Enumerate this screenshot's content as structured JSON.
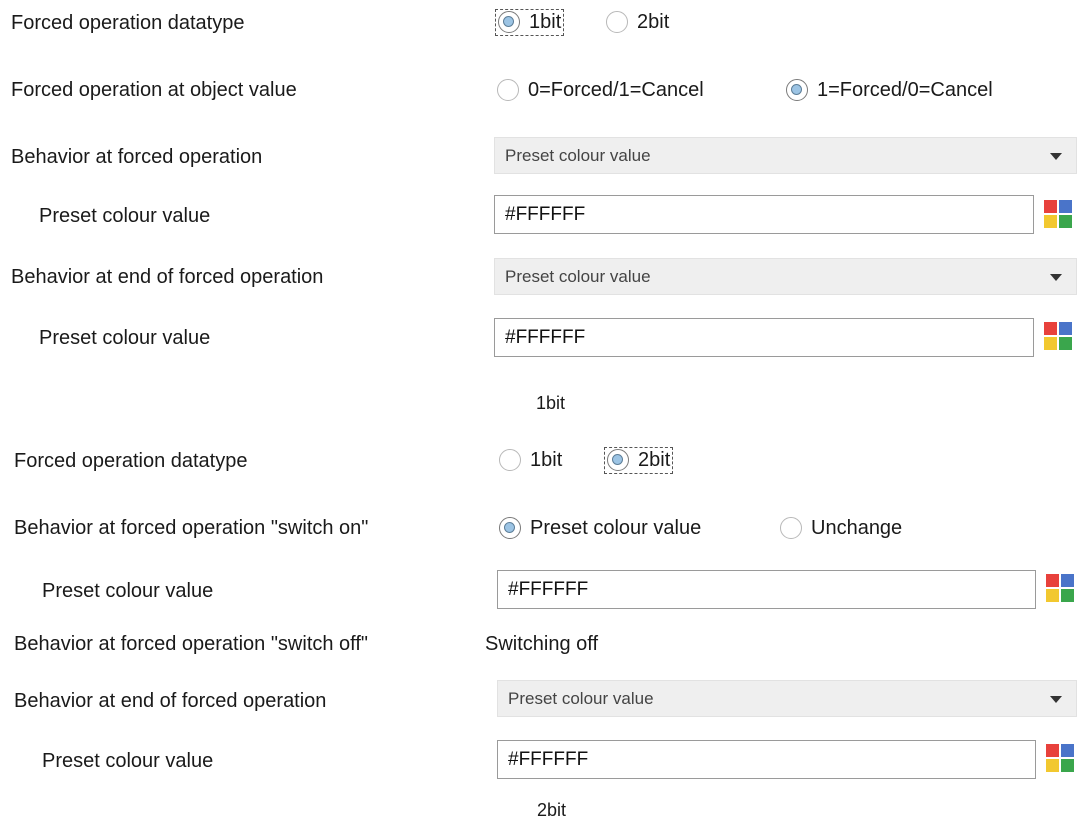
{
  "section1": {
    "datatype": {
      "label": "Forced operation datatype",
      "options": [
        "1bit",
        "2bit"
      ],
      "selected": "1bit"
    },
    "object_value": {
      "label": "Forced operation at object value",
      "options": [
        "0=Forced/1=Cancel",
        "1=Forced/0=Cancel"
      ],
      "selected": "1=Forced/0=Cancel"
    },
    "behavior_forced": {
      "label": "Behavior at forced operation",
      "value": "Preset colour value"
    },
    "preset1": {
      "label": "Preset colour value",
      "value": "#FFFFFF"
    },
    "behavior_end": {
      "label": "Behavior at end of forced operation",
      "value": "Preset colour value"
    },
    "preset2": {
      "label": "Preset colour value",
      "value": "#FFFFFF"
    },
    "caption": "1bit"
  },
  "section2": {
    "datatype": {
      "label": "Forced operation datatype",
      "options": [
        "1bit",
        "2bit"
      ],
      "selected": "2bit"
    },
    "switch_on": {
      "label": "Behavior at forced operation \"switch on\"",
      "options": [
        "Preset colour value",
        "Unchange"
      ],
      "selected": "Preset colour value"
    },
    "preset1": {
      "label": "Preset colour value",
      "value": "#FFFFFF"
    },
    "switch_off": {
      "label": "Behavior at forced operation \"switch off\"",
      "value": "Switching off"
    },
    "behavior_end": {
      "label": "Behavior at end of forced operation",
      "value": "Preset colour value"
    },
    "preset2": {
      "label": "Preset colour value",
      "value": "#FFFFFF"
    },
    "caption": "2bit"
  },
  "colors": {
    "red": "#e8413c",
    "blue": "#4a74c9",
    "yellow": "#f2c82f",
    "green": "#3aa64c"
  }
}
